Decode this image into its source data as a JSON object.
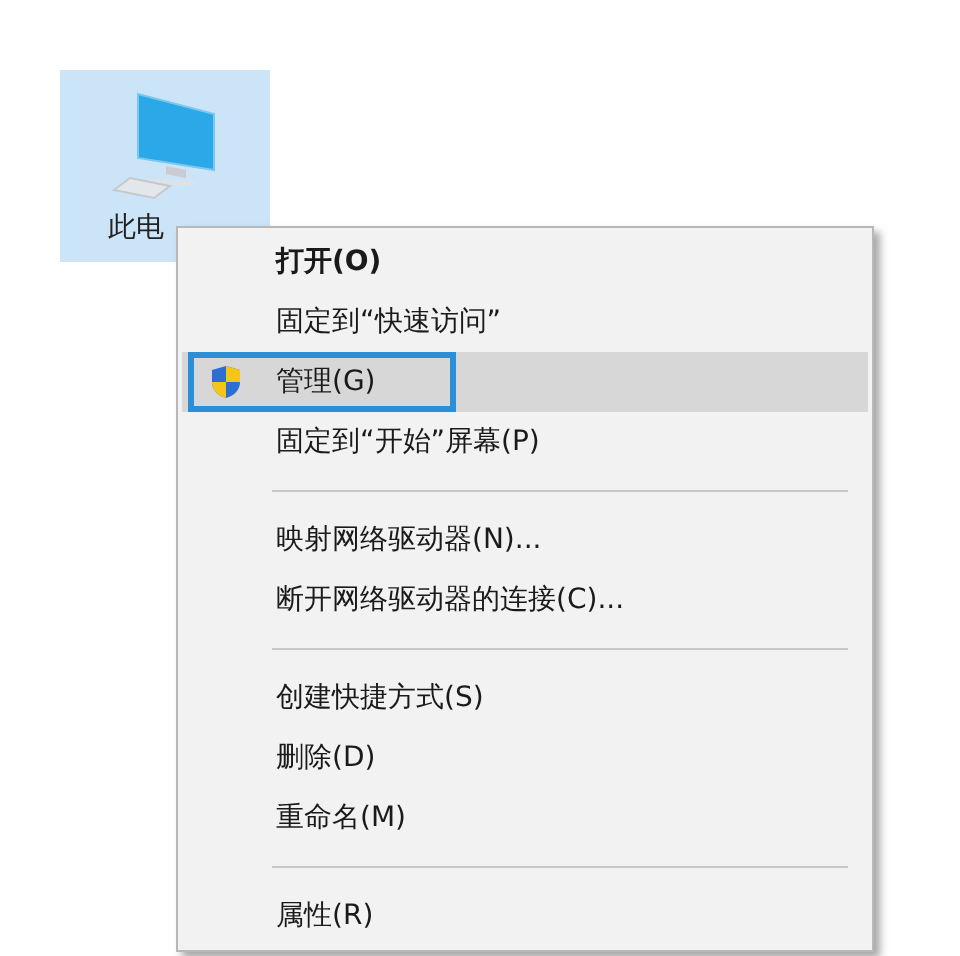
{
  "desktop_icon": {
    "label": "此电",
    "selected": true
  },
  "context_menu": {
    "items": [
      {
        "kind": "item",
        "label": "打开(O)",
        "bold": true,
        "highlighted": false,
        "shield": false,
        "outlined": false
      },
      {
        "kind": "item",
        "label": "固定到“快速访问”",
        "bold": false,
        "highlighted": false,
        "shield": false,
        "outlined": false
      },
      {
        "kind": "item",
        "label": "管理(G)",
        "bold": false,
        "highlighted": true,
        "shield": true,
        "outlined": true
      },
      {
        "kind": "item",
        "label": "固定到“开始”屏幕(P)",
        "bold": false,
        "highlighted": false,
        "shield": false,
        "outlined": false
      },
      {
        "kind": "separator"
      },
      {
        "kind": "item",
        "label": "映射网络驱动器(N)...",
        "bold": false,
        "highlighted": false,
        "shield": false,
        "outlined": false
      },
      {
        "kind": "item",
        "label": "断开网络驱动器的连接(C)...",
        "bold": false,
        "highlighted": false,
        "shield": false,
        "outlined": false
      },
      {
        "kind": "separator"
      },
      {
        "kind": "item",
        "label": "创建快捷方式(S)",
        "bold": false,
        "highlighted": false,
        "shield": false,
        "outlined": false
      },
      {
        "kind": "item",
        "label": "删除(D)",
        "bold": false,
        "highlighted": false,
        "shield": false,
        "outlined": false
      },
      {
        "kind": "item",
        "label": "重命名(M)",
        "bold": false,
        "highlighted": false,
        "shield": false,
        "outlined": false
      },
      {
        "kind": "separator"
      },
      {
        "kind": "item",
        "label": "属性(R)",
        "bold": false,
        "highlighted": false,
        "shield": false,
        "outlined": false
      }
    ]
  }
}
